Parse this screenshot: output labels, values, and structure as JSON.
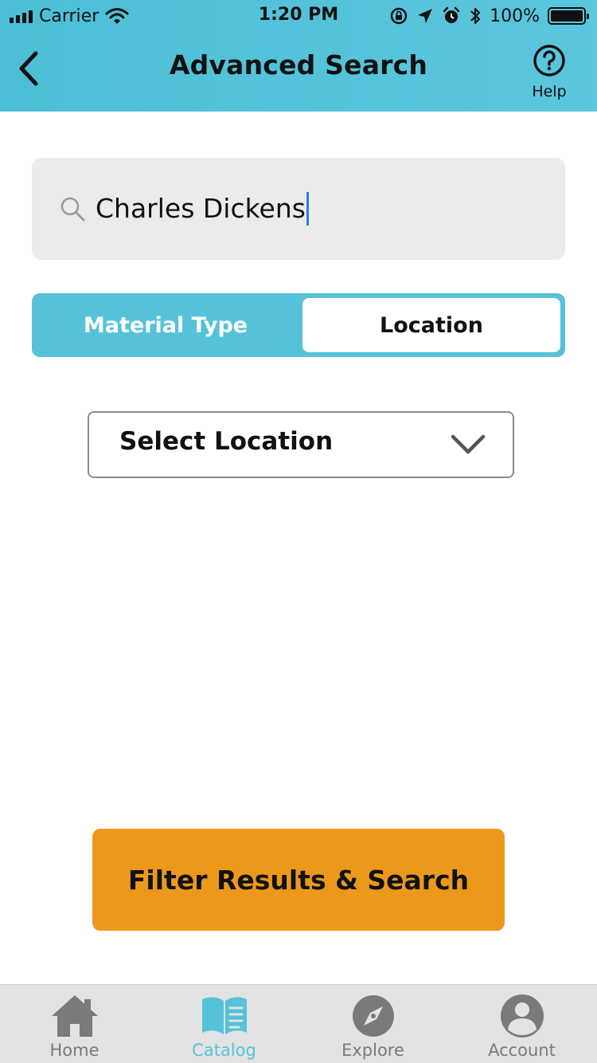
{
  "status_bar": {
    "carrier": "Carrier",
    "time": "1:20 PM",
    "battery_percent": "100%",
    "signal_bars": 4
  },
  "nav": {
    "title": "Advanced Search",
    "help_label": "Help",
    "back_icon": "chevron-left-icon",
    "help_icon": "question-circle-icon"
  },
  "search": {
    "value": "Charles Dickens",
    "icon": "search-icon"
  },
  "segmented": {
    "options": [
      "Material Type",
      "Location"
    ],
    "selected": "Location"
  },
  "location_select": {
    "selected_label": "Select Location",
    "icon": "chevron-down-icon"
  },
  "primary_button": {
    "label": "Filter Results & Search"
  },
  "tab_bar": {
    "items": [
      {
        "label": "Home",
        "icon": "home-icon",
        "active": false
      },
      {
        "label": "Catalog",
        "icon": "book-icon",
        "active": true
      },
      {
        "label": "Explore",
        "icon": "compass-icon",
        "active": false
      },
      {
        "label": "Account",
        "icon": "user-icon",
        "active": false
      }
    ]
  },
  "colors": {
    "header": "#5bc6de",
    "accent": "#56c2d9",
    "primary_button": "#ec991b",
    "search_bg": "#ebebeb",
    "tab_bar_bg": "#e3e3e3",
    "inactive_tab": "#7a7a7a",
    "caret": "#3b73e8"
  }
}
